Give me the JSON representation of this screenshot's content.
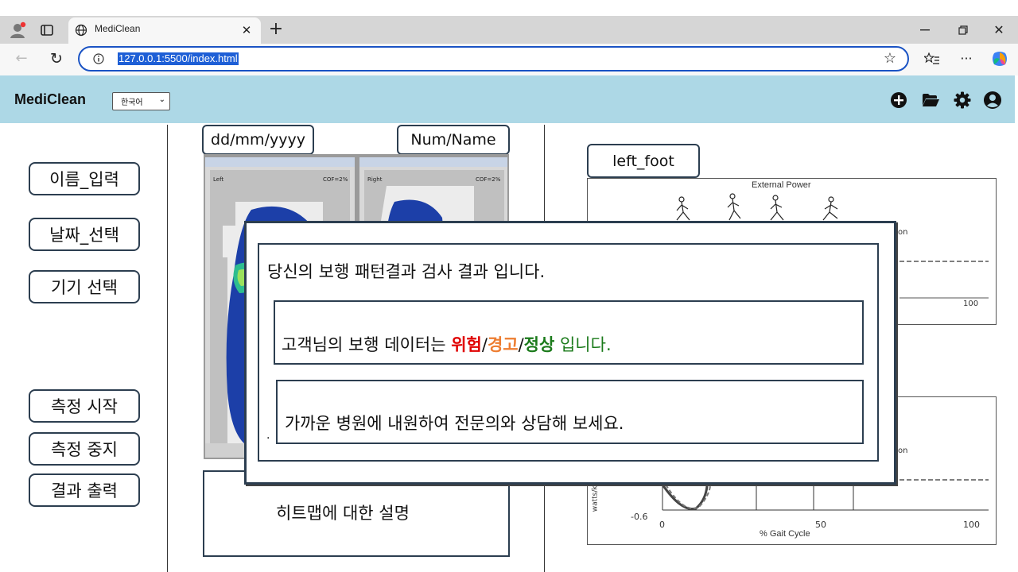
{
  "browser": {
    "tab_title": "MediClean",
    "new_tab": "+",
    "url": "127.0.0.1:5500/index.html"
  },
  "app": {
    "title": "MediClean",
    "language": "한국어"
  },
  "sidebar": {
    "buttons": [
      "이름_입력",
      "날짜_선택",
      "기기 선택",
      "측정 시작",
      "측정 중지",
      "결과 출력"
    ]
  },
  "middle": {
    "date_placeholder": "dd/mm/yyyy",
    "id_placeholder": "Num/Name",
    "heatmap_left_label": "Left",
    "heatmap_right_label": "Right",
    "heatmap_cop_left": "COF=2%",
    "heatmap_cop_right": "COF=2%",
    "heatmap_description": "히트맵에 대한 설명"
  },
  "right": {
    "foot_label": "left_foot",
    "chart1_title": "External Power",
    "chart1_partial_legend": "on",
    "chart1_x_end": "100",
    "chart2_partial_legend": "on",
    "chart2_ylabel": "watts/kg",
    "chart2_y_min": "-0.6",
    "chart2_ticks": [
      "0",
      "50",
      "100"
    ],
    "chart2_xlabel": "% Gait Cycle"
  },
  "modal": {
    "title": "당신의 보행 패턴결과 검사 결과 입니다.",
    "result_prefix": "고객님의 보행 데이터는 ",
    "status_danger": "위험",
    "sep": "/",
    "status_warn": "경고",
    "status_normal": "정상",
    "result_suffix": " 입니다.",
    "advice": "가까운 병원에 내원하여 전문의와 상담해 보세요.",
    "dot": "."
  },
  "colors": {
    "header_bg": "#add8e6",
    "danger": "#e00000",
    "warning": "#ed7d31",
    "normal": "#1a7a1a",
    "url_highlight": "#1e5fd6"
  }
}
